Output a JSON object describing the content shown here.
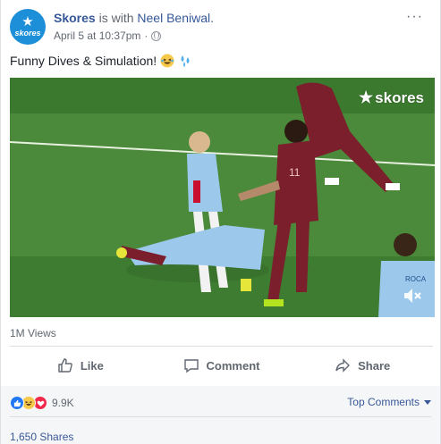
{
  "post": {
    "author": "Skores",
    "with_text": "is with",
    "tagged_user": "Neel Beniwal.",
    "timestamp": "April 5 at 10:37pm",
    "separator": "·",
    "privacy_icon": "globe-icon",
    "more_label": "···",
    "caption": "Funny Dives & Simulation!",
    "caption_emojis": [
      "laughing-emoji",
      "sweat-droplets-emoji"
    ]
  },
  "avatar": {
    "brand": "skores"
  },
  "video": {
    "watermark": "skores",
    "mute_icon": "speaker-muted-icon",
    "colors": {
      "pitch": "#4a8a3a",
      "home_kit": "#7a1f2b",
      "away_kit": "#9cc8ec"
    }
  },
  "stats": {
    "views": "1M Views",
    "reaction_count": "9.9K",
    "reactions": [
      "like",
      "haha",
      "love"
    ],
    "shares": "1,650 Shares"
  },
  "actions": {
    "like": "Like",
    "comment": "Comment",
    "share": "Share"
  },
  "comments": {
    "filter_label": "Top Comments"
  },
  "colors": {
    "link": "#365899",
    "muted": "#606770",
    "footer_bg": "#f5f6f7"
  }
}
